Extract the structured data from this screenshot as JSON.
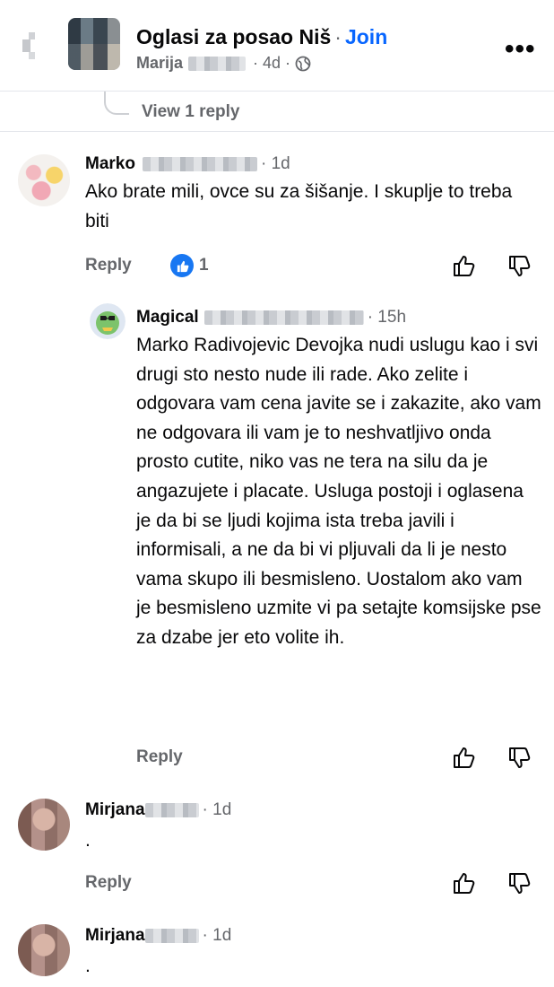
{
  "header": {
    "group_name": "Oglasi za posao Niš",
    "separator": "·",
    "join_label": "Join",
    "author": "Marija",
    "time": "· 4d ·",
    "icons": {
      "back": "chevron-left-icon",
      "privacy": "globe-icon",
      "more": "more-icon"
    }
  },
  "thread": {
    "view_replies": "View 1 reply"
  },
  "comments": [
    {
      "name": "Marko",
      "time": "· 1d",
      "text": "Ako brate mili, ovce su za šišanje. I skuplje to treba biti",
      "reply_label": "Reply",
      "reactions": "1"
    },
    {
      "name": "Magical",
      "time": "· 15h",
      "text": "Marko Radivojevic Devojka nudi uslugu kao i svi drugi sto nesto nude ili rade. Ako zelite i odgovara vam cena javite se i zakazite, ako vam ne odgovara ili vam je to neshvatljivo onda prosto cutite, niko vas ne tera na silu da je angazujete i placate. Usluga postoji i oglasena je da bi se ljudi kojima ista treba javili i informisali, a ne da bi vi pljuvali da li je nesto vama skupo ili besmisleno. Uostalom ako vam je besmisleno uzmite vi pa setajte komsijske pse za dzabe jer eto volite ih.",
      "reply_label": "Reply"
    },
    {
      "name": "Mirjana",
      "time": "· 1d",
      "text": ".",
      "reply_label": "Reply"
    },
    {
      "name": "Mirjana",
      "time": "· 1d",
      "text": "."
    }
  ],
  "colors": {
    "accent": "#0866ff",
    "like_blue": "#1877f2",
    "secondary_text": "#65676b"
  }
}
